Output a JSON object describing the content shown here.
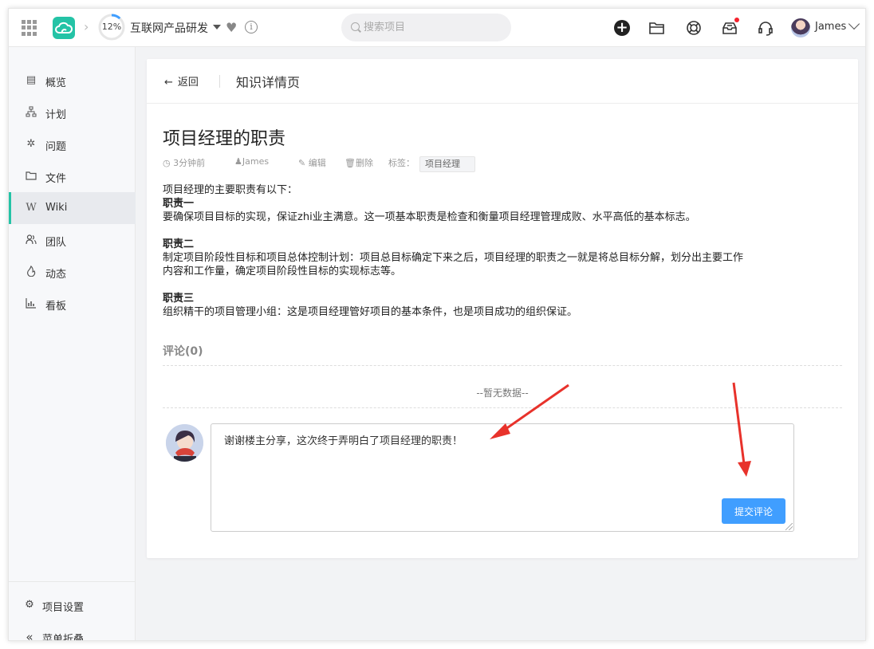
{
  "header": {
    "project_progress": "12%",
    "project_progress_value": 0.12,
    "project_name": "互联网产品研发",
    "search_placeholder": "搜索项目",
    "user_name": "James",
    "icons": [
      "apps-grid-icon",
      "cloud-logo-icon",
      "chevron-right-icon",
      "heart-icon",
      "info-icon",
      "plus-icon",
      "folder-icon",
      "lifebuoy-icon",
      "inbox-icon",
      "headset-icon"
    ]
  },
  "sidebar": {
    "items": [
      {
        "label": "概览",
        "icon": "overview-icon"
      },
      {
        "label": "计划",
        "icon": "plan-icon"
      },
      {
        "label": "问题",
        "icon": "bug-icon"
      },
      {
        "label": "文件",
        "icon": "folder-icon"
      },
      {
        "label": "Wiki",
        "icon": "wiki-icon"
      },
      {
        "label": "团队",
        "icon": "team-icon"
      },
      {
        "label": "动态",
        "icon": "activity-icon"
      },
      {
        "label": "看板",
        "icon": "chart-icon"
      }
    ],
    "active": "Wiki",
    "settings_label": "项目设置",
    "collapse_label": "菜单折叠"
  },
  "page": {
    "back_label": "返回",
    "title": "知识详情页"
  },
  "article": {
    "title": "项目经理的职责",
    "time": "3分钟前",
    "author": "James",
    "edit_label": "编辑",
    "delete_label": "删除",
    "tag_label": "标签：",
    "tag": "项目经理",
    "lines": [
      {
        "text": "项目经理的主要职责有以下：",
        "bold": false
      },
      {
        "text": "职责一",
        "bold": true
      },
      {
        "text": "要确保项目目标的实现，保证zhi业主满意。这一项基本职责是检查和衡量项目经理管理成败、水平高低的基本标志。",
        "bold": false
      },
      {
        "text": "",
        "bold": false
      },
      {
        "text": "职责二",
        "bold": true
      },
      {
        "text": "制定项目阶段性目标和项目总体控制计划：项目总目标确定下来之后，项目经理的职责之一就是将总目标分解，划分出主要工作",
        "bold": false
      },
      {
        "text": "内容和工作量，确定项目阶段性目标的实现标志等。",
        "bold": false
      },
      {
        "text": "",
        "bold": false
      },
      {
        "text": "职责三",
        "bold": true
      },
      {
        "text": "组织精干的项目管理小组：这是项目经理管好项目的基本条件，也是项目成功的组织保证。",
        "bold": false
      }
    ]
  },
  "comments": {
    "title": "评论(0)",
    "empty_text": "--暂无数据--",
    "draft": "谢谢楼主分享，这次终于弄明白了项目经理的职责！",
    "submit_label": "提交评论"
  },
  "colors": {
    "brand": "#24c3a6",
    "primary_button": "#409eff",
    "annotation_arrow": "#e8322b"
  }
}
